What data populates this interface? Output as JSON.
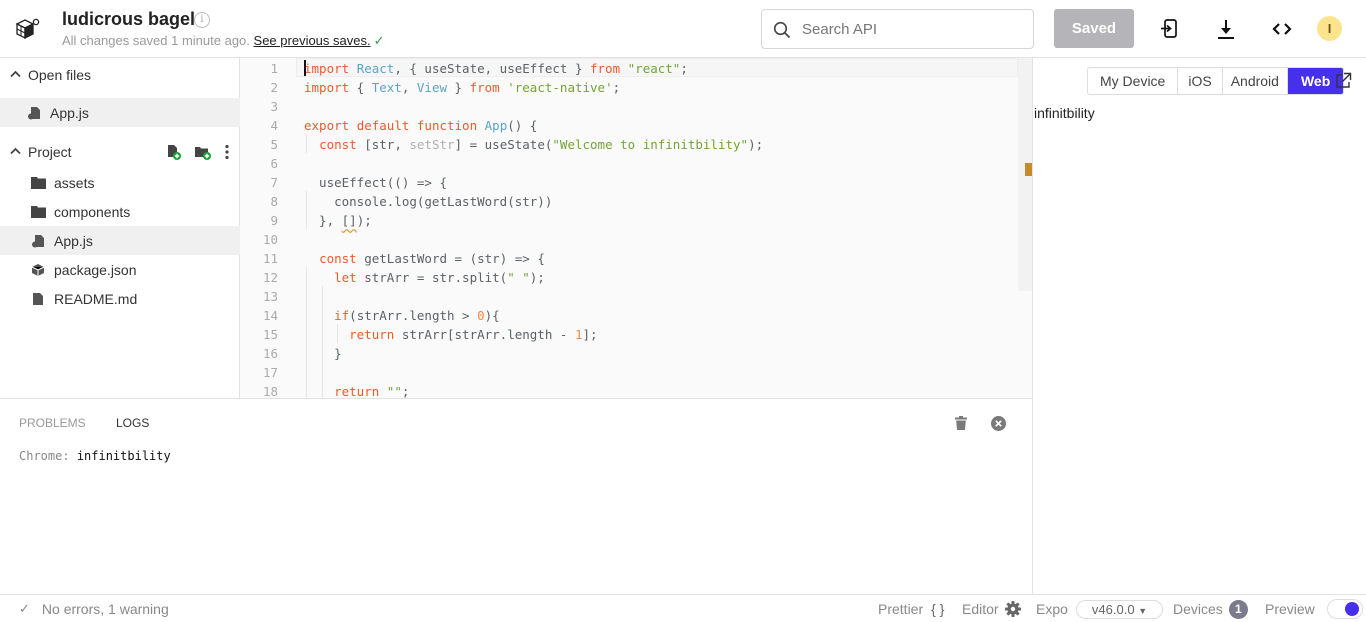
{
  "header": {
    "project_title": "ludicrous bagel",
    "save_status": "All changes saved 1 minute ago.",
    "previous_saves_link": "See previous saves.",
    "search_placeholder": "Search API",
    "search_value": "",
    "saved_button": "Saved",
    "avatar_initial": "I",
    "icons": [
      "project-logo-icon",
      "info-icon",
      "search-icon",
      "run-on-device-icon",
      "download-icon",
      "embed-code-icon"
    ]
  },
  "sidebar": {
    "open_files_label": "Open files",
    "open_files": [
      {
        "name": "App.js",
        "icon": "js-file-icon",
        "active": true
      }
    ],
    "project_label": "Project",
    "project_actions": [
      "new-file-icon",
      "new-folder-icon",
      "more-options-icon"
    ],
    "project_files": [
      {
        "name": "assets",
        "icon": "folder-icon",
        "active": false
      },
      {
        "name": "components",
        "icon": "folder-icon",
        "active": false
      },
      {
        "name": "App.js",
        "icon": "js-file-icon",
        "active": true
      },
      {
        "name": "package.json",
        "icon": "package-icon",
        "active": false
      },
      {
        "name": "README.md",
        "icon": "markdown-file-icon",
        "active": false
      }
    ]
  },
  "editor": {
    "line_numbers": [
      "1",
      "2",
      "3",
      "4",
      "5",
      "6",
      "7",
      "8",
      "9",
      "10",
      "11",
      "12",
      "13",
      "14",
      "15",
      "16",
      "17",
      "18"
    ],
    "code_lines": [
      "import React, { useState, useEffect } from \"react\";",
      "import { Text, View } from 'react-native';",
      "",
      "export default function App() {",
      "  const [str, setStr] = useState(\"Welcome to infinitbility\");",
      "",
      "  useEffect(() => {",
      "    console.log(getLastWord(str))",
      "  }, []);",
      "",
      "  const getLastWord = (str) => {",
      "    let strArr = str.split(\" \");",
      "",
      "    if(strArr.length > 0){",
      "      return strArr[strArr.length - 1];",
      "    }",
      "",
      "    return \"\";"
    ],
    "warning_color": "#c38b2a"
  },
  "preview": {
    "platform_tabs": [
      "My Device",
      "iOS",
      "Android",
      "Web"
    ],
    "selected_platform": "Web",
    "accent_color": "#4630eb",
    "output_text": "infinitbility"
  },
  "console": {
    "tabs": [
      "PROBLEMS",
      "LOGS"
    ],
    "active_tab": "LOGS",
    "logs": [
      {
        "source": "Chrome:",
        "message": "infinitbility"
      }
    ]
  },
  "footer": {
    "status": "No errors, 1 warning",
    "prettier_label": "Prettier",
    "prettier_icon": "{ }",
    "editor_label": "Editor",
    "expo_label": "Expo",
    "sdk_version": "v46.0.0",
    "devices_label": "Devices",
    "devices_count": "1",
    "preview_label": "Preview",
    "preview_enabled": true
  }
}
